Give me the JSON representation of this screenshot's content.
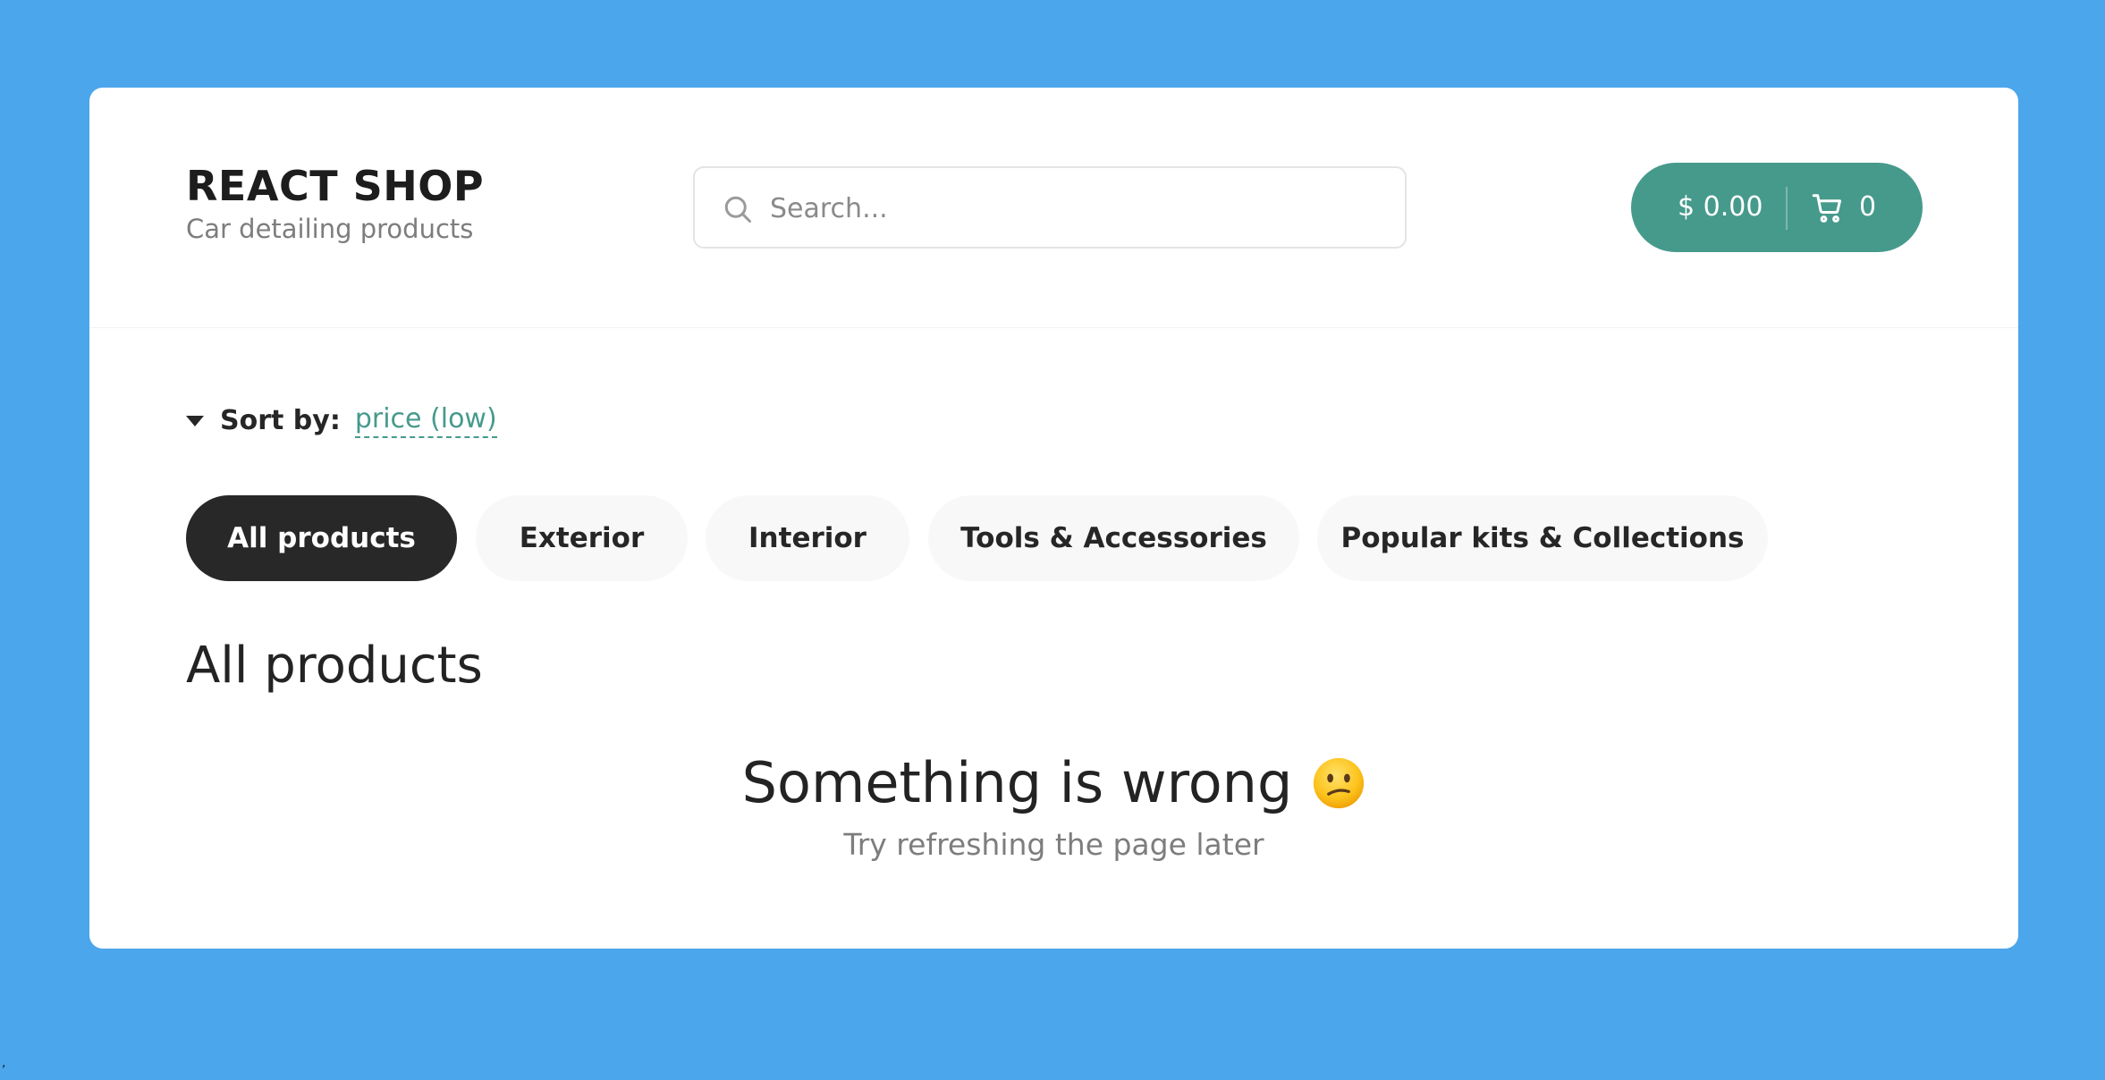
{
  "header": {
    "title": "REACT SHOP",
    "subtitle": "Car detailing products"
  },
  "search": {
    "placeholder": "Search...",
    "value": ""
  },
  "cart": {
    "price": "$ 0.00",
    "count": "0"
  },
  "sort": {
    "label": "Sort by:",
    "value": "price (low)"
  },
  "categories": [
    {
      "label": "All products",
      "active": true
    },
    {
      "label": "Exterior",
      "active": false
    },
    {
      "label": "Interior",
      "active": false
    },
    {
      "label": "Tools & Accessories",
      "active": false
    },
    {
      "label": "Popular kits & Collections",
      "active": false
    }
  ],
  "content": {
    "title": "All products",
    "error_heading": "Something is wrong",
    "error_message": "Try refreshing the page later"
  },
  "stray_mark": ",",
  "colors": {
    "page_background": "#4ca6ec",
    "accent": "#469a8c",
    "active_category": "#282828",
    "category_background": "#f8f8f8"
  },
  "icons": {
    "search": "search-icon",
    "cart": "cart-icon",
    "sort": "caret-down-icon",
    "error": "confused-face-icon"
  }
}
